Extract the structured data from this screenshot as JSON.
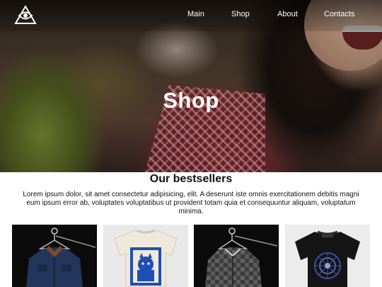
{
  "nav": {
    "logo_icon": "eye-triangle-logo-icon",
    "items": [
      {
        "label": "Main"
      },
      {
        "label": "Shop"
      },
      {
        "label": "About"
      },
      {
        "label": "Contacts"
      }
    ]
  },
  "hero": {
    "title": "Shop"
  },
  "bestsellers": {
    "title": "Our bestsellers",
    "description": "Lorem ipsum dolor, sit amet consectetur adipisicing, elit. A deserunt iste omnis exercitationem debitis magni eum ipsum error ab, voluptates voluptatibus ut provident totam quia et consequuntur aliquam, voluptatum minima."
  },
  "products": [
    {
      "item": "denim-jacket",
      "background": "#0b0b0b",
      "color": "#22355b"
    },
    {
      "item": "cat-print-tshirt",
      "background": "#e9e9e9",
      "color": "#efe9dc",
      "accent": "#1f4fb3"
    },
    {
      "item": "plaid-shirt",
      "background": "#0b0b0b",
      "color": "#3a3a3a"
    },
    {
      "item": "black-graphic-tshirt",
      "background": "#ececec",
      "color": "#151515",
      "accent": "#3b4fa8"
    }
  ]
}
